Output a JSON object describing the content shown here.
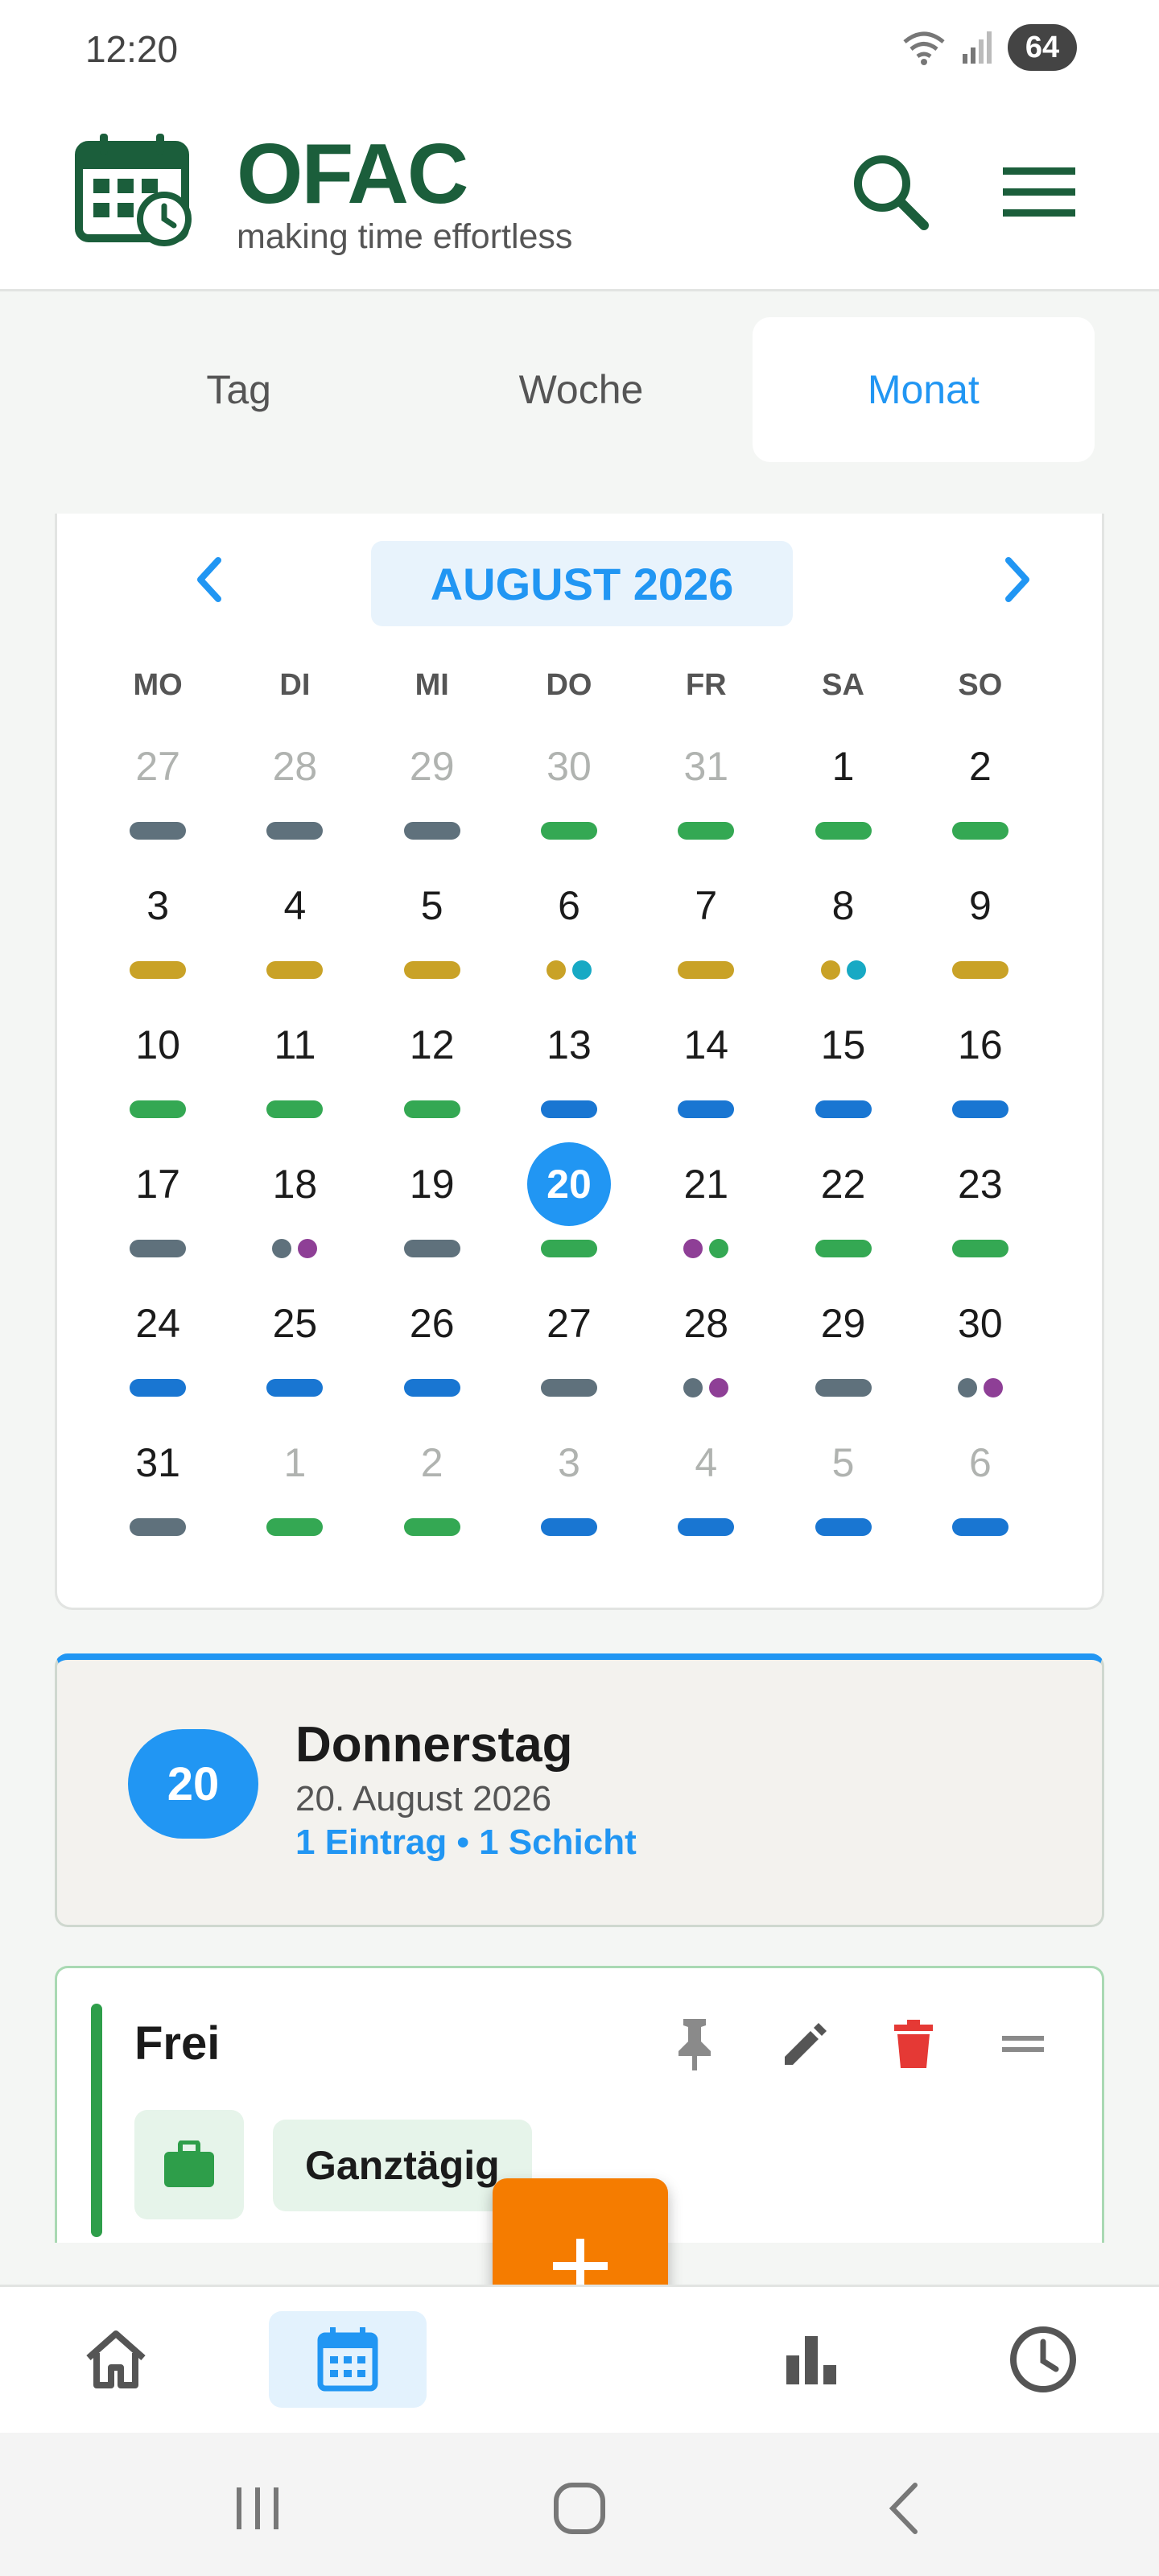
{
  "status": {
    "time": "12:20",
    "battery": "64"
  },
  "header": {
    "title": "OFAC",
    "subtitle": "making time effortless"
  },
  "tabs": [
    {
      "label": "Tag",
      "active": false
    },
    {
      "label": "Woche",
      "active": false
    },
    {
      "label": "Monat",
      "active": true
    }
  ],
  "calendar": {
    "month_label": "AUGUST 2026",
    "weekdays": [
      "MO",
      "DI",
      "MI",
      "DO",
      "FR",
      "SA",
      "SO"
    ],
    "colors": {
      "slate": "#5f717c",
      "green": "#34a853",
      "gold": "#c9a227",
      "teal": "#17a9c4",
      "blue": "#1976d2",
      "purple": "#8e3f96"
    },
    "days": [
      {
        "num": "27",
        "out": true,
        "marks": [
          "bar:slate"
        ]
      },
      {
        "num": "28",
        "out": true,
        "marks": [
          "bar:slate"
        ]
      },
      {
        "num": "29",
        "out": true,
        "marks": [
          "bar:slate"
        ]
      },
      {
        "num": "30",
        "out": true,
        "marks": [
          "bar:green"
        ]
      },
      {
        "num": "31",
        "out": true,
        "marks": [
          "bar:green"
        ]
      },
      {
        "num": "1",
        "marks": [
          "bar:green"
        ]
      },
      {
        "num": "2",
        "marks": [
          "bar:green"
        ]
      },
      {
        "num": "3",
        "marks": [
          "bar:gold"
        ]
      },
      {
        "num": "4",
        "marks": [
          "bar:gold"
        ]
      },
      {
        "num": "5",
        "marks": [
          "bar:gold"
        ]
      },
      {
        "num": "6",
        "marks": [
          "dot:gold",
          "dot:teal"
        ]
      },
      {
        "num": "7",
        "marks": [
          "bar:gold"
        ]
      },
      {
        "num": "8",
        "marks": [
          "dot:gold",
          "dot:teal"
        ]
      },
      {
        "num": "9",
        "marks": [
          "bar:gold"
        ]
      },
      {
        "num": "10",
        "marks": [
          "bar:green"
        ]
      },
      {
        "num": "11",
        "marks": [
          "bar:green"
        ]
      },
      {
        "num": "12",
        "marks": [
          "bar:green"
        ]
      },
      {
        "num": "13",
        "marks": [
          "bar:blue"
        ]
      },
      {
        "num": "14",
        "marks": [
          "bar:blue"
        ]
      },
      {
        "num": "15",
        "marks": [
          "bar:blue"
        ]
      },
      {
        "num": "16",
        "marks": [
          "bar:blue"
        ]
      },
      {
        "num": "17",
        "marks": [
          "bar:slate"
        ]
      },
      {
        "num": "18",
        "marks": [
          "dot:slate",
          "dot:purple"
        ]
      },
      {
        "num": "19",
        "marks": [
          "bar:slate"
        ]
      },
      {
        "num": "20",
        "today": true,
        "marks": [
          "bar:green"
        ]
      },
      {
        "num": "21",
        "marks": [
          "dot:purple",
          "dot:green"
        ]
      },
      {
        "num": "22",
        "marks": [
          "bar:green"
        ]
      },
      {
        "num": "23",
        "marks": [
          "bar:green"
        ]
      },
      {
        "num": "24",
        "marks": [
          "bar:blue"
        ]
      },
      {
        "num": "25",
        "marks": [
          "bar:blue"
        ]
      },
      {
        "num": "26",
        "marks": [
          "bar:blue"
        ]
      },
      {
        "num": "27",
        "marks": [
          "bar:slate"
        ]
      },
      {
        "num": "28",
        "marks": [
          "dot:slate",
          "dot:purple"
        ]
      },
      {
        "num": "29",
        "marks": [
          "bar:slate"
        ]
      },
      {
        "num": "30",
        "marks": [
          "dot:slate",
          "dot:purple"
        ]
      },
      {
        "num": "31",
        "marks": [
          "bar:slate"
        ]
      },
      {
        "num": "1",
        "out": true,
        "marks": [
          "bar:green"
        ]
      },
      {
        "num": "2",
        "out": true,
        "marks": [
          "bar:green"
        ]
      },
      {
        "num": "3",
        "out": true,
        "marks": [
          "bar:blue"
        ]
      },
      {
        "num": "4",
        "out": true,
        "marks": [
          "bar:blue"
        ]
      },
      {
        "num": "5",
        "out": true,
        "marks": [
          "bar:blue"
        ]
      },
      {
        "num": "6",
        "out": true,
        "marks": [
          "bar:blue"
        ]
      }
    ]
  },
  "selected_day": {
    "badge": "20",
    "weekday": "Donnerstag",
    "date": "20. August 2026",
    "summary": "1 Eintrag • 1 Schicht"
  },
  "entry": {
    "title": "Frei",
    "chip": "Ganztägig",
    "accent": "#2e9e4a",
    "actions": [
      "pin-icon",
      "edit-icon",
      "delete-icon",
      "drag-handle-icon"
    ]
  },
  "fab": {
    "icon": "plus-icon",
    "color": "#f57c00"
  },
  "bottom_nav": [
    "home-icon",
    "calendar-icon",
    "stats-icon",
    "clock-icon"
  ],
  "brand_color": "#1b5e3b",
  "accent_color": "#2196f3"
}
